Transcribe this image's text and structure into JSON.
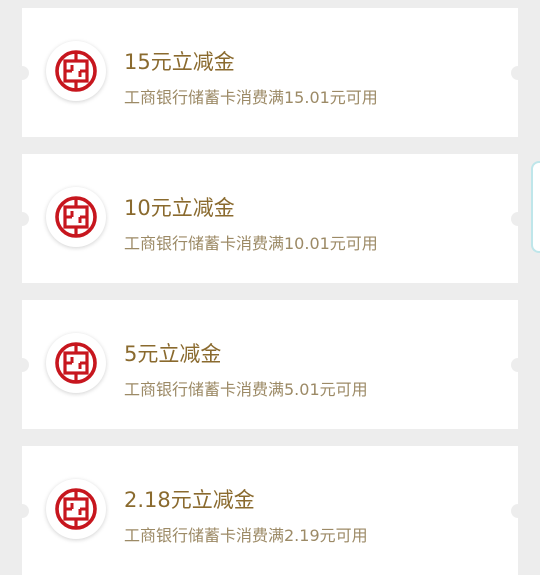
{
  "brand_color": "#c7161e",
  "coupons": [
    {
      "title": "15元立减金",
      "desc": "工商银行储蓄卡消费满15.01元可用",
      "icon": "icbc-logo-icon"
    },
    {
      "title": "10元立减金",
      "desc": "工商银行储蓄卡消费满10.01元可用",
      "icon": "icbc-logo-icon"
    },
    {
      "title": "5元立减金",
      "desc": "工商银行储蓄卡消费满5.01元可用",
      "icon": "icbc-logo-icon"
    },
    {
      "title": "2.18元立减金",
      "desc": "工商银行储蓄卡消费满2.19元可用",
      "icon": "icbc-logo-icon"
    }
  ]
}
